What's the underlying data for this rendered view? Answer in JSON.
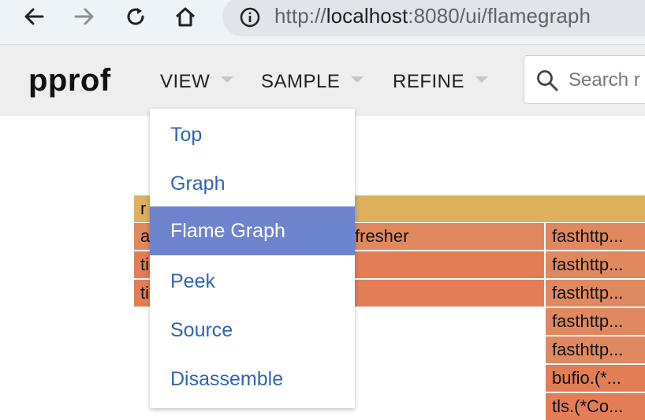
{
  "browser": {
    "url_scheme": "http://",
    "url_host": "localhost",
    "url_rest": ":8080/ui/flamegraph"
  },
  "header": {
    "brand": "pprof",
    "menus": [
      {
        "label": "VIEW"
      },
      {
        "label": "SAMPLE"
      },
      {
        "label": "REFINE"
      }
    ],
    "search_placeholder": "Search r"
  },
  "flamegraph": {
    "rows": [
      {
        "left": "r"
      },
      {
        "left": "a",
        "middle": "fresher",
        "right": "fasthttp..."
      },
      {
        "left": "ti",
        "right": "fasthttp..."
      },
      {
        "left": "ti",
        "right": "fasthttp..."
      },
      {
        "right": "fasthttp..."
      },
      {
        "right": "fasthttp..."
      },
      {
        "right": "bufio.(*..."
      },
      {
        "right": "tls.(*Co..."
      }
    ]
  },
  "view_menu": {
    "items": [
      "Top",
      "Graph",
      "Flame Graph",
      "Peek",
      "Source",
      "Disassemble"
    ],
    "selected": "Flame Graph"
  },
  "colors": {
    "root": "#dcb05c",
    "frame": "#e0885f",
    "selected_bg": "#6e84cf",
    "link": "#2f64b7"
  }
}
